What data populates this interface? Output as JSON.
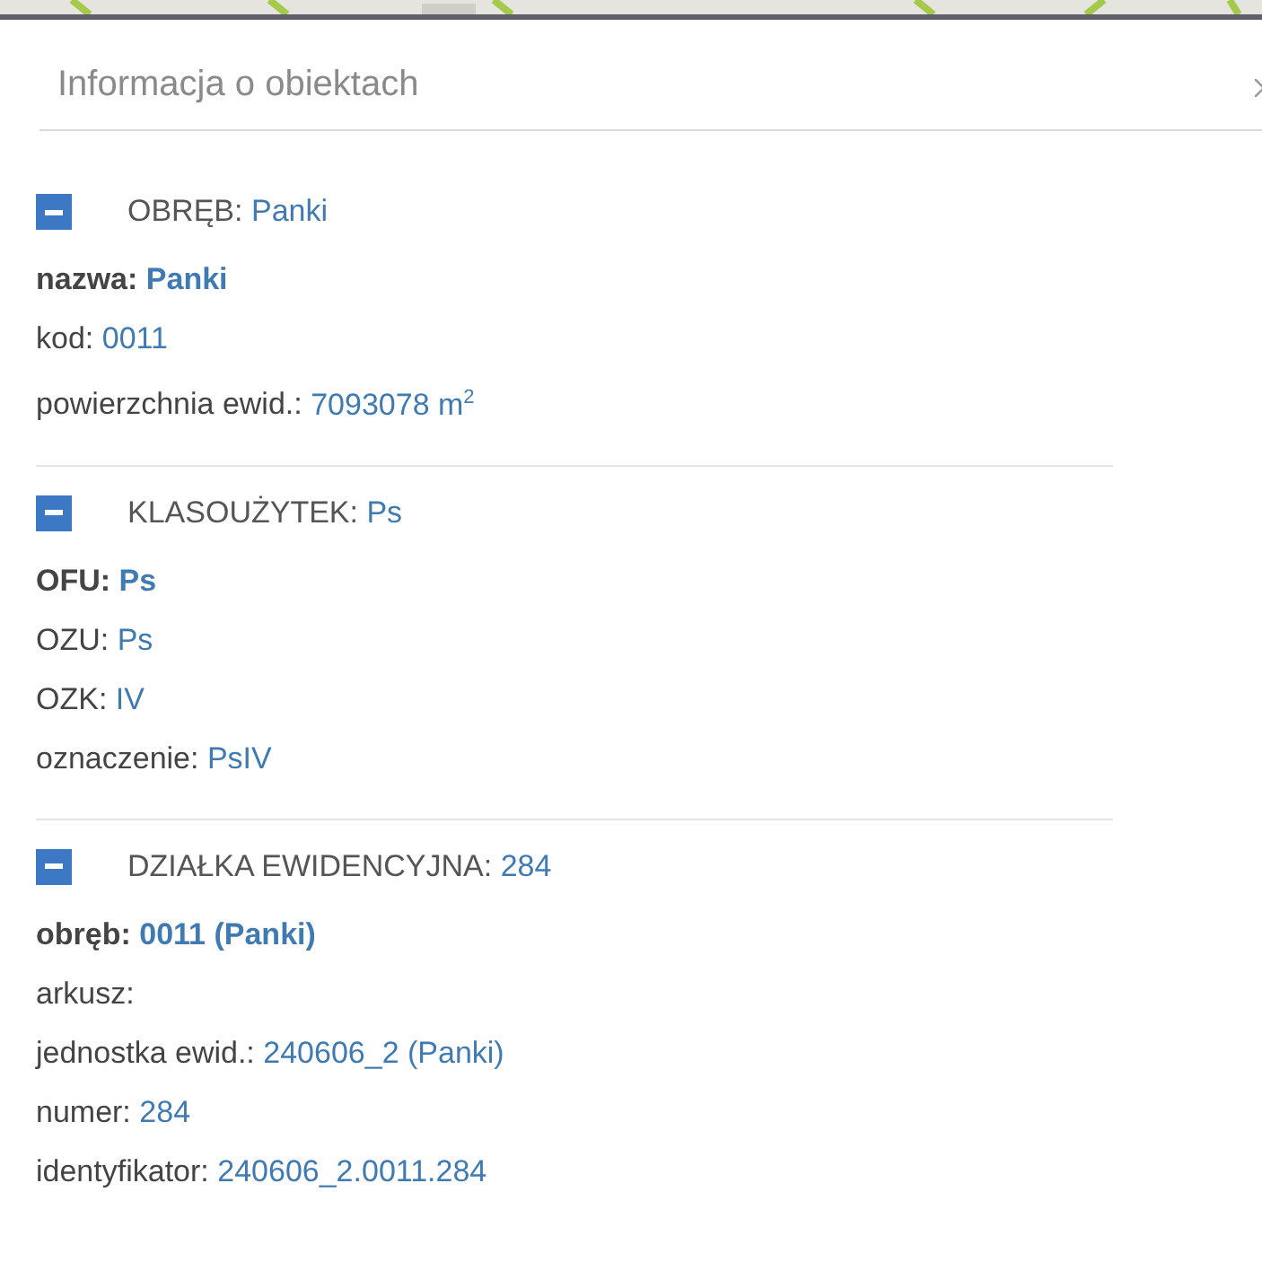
{
  "panel": {
    "title": "Informacja o obiektach"
  },
  "sections": [
    {
      "label": "OBRĘB:",
      "value": "Panki",
      "expanded": true,
      "rows": [
        {
          "key": "nazwa:",
          "value": "Panki",
          "bold": true
        },
        {
          "key": "kod:",
          "value": "0011",
          "bold": false
        },
        {
          "key": "powierzchnia ewid.:",
          "value": "7093078 m$^{2}$",
          "bold": false
        }
      ]
    },
    {
      "label": "KLASOUŻYTEK:",
      "value": "Ps",
      "expanded": true,
      "rows": [
        {
          "key": "OFU:",
          "value": "Ps",
          "bold": true
        },
        {
          "key": "OZU:",
          "value": "Ps",
          "bold": false
        },
        {
          "key": "OZK:",
          "value": "IV",
          "bold": false
        },
        {
          "key": "oznaczenie:",
          "value": "PsIV",
          "bold": false
        }
      ]
    },
    {
      "label": "DZIAŁKA EWIDENCYJNA:",
      "value": "284",
      "expanded": true,
      "rows": [
        {
          "key": "obręb:",
          "value": "0011 (Panki)",
          "bold": true
        },
        {
          "key": "arkusz:",
          "value": "",
          "bold": false
        },
        {
          "key": "jednostka ewid.:",
          "value": "240606_2 (Panki)",
          "bold": false
        },
        {
          "key": "numer:",
          "value": "284",
          "bold": false
        },
        {
          "key": "identyfikator:",
          "value": "240606_2.0011.284",
          "bold": false
        }
      ]
    }
  ]
}
